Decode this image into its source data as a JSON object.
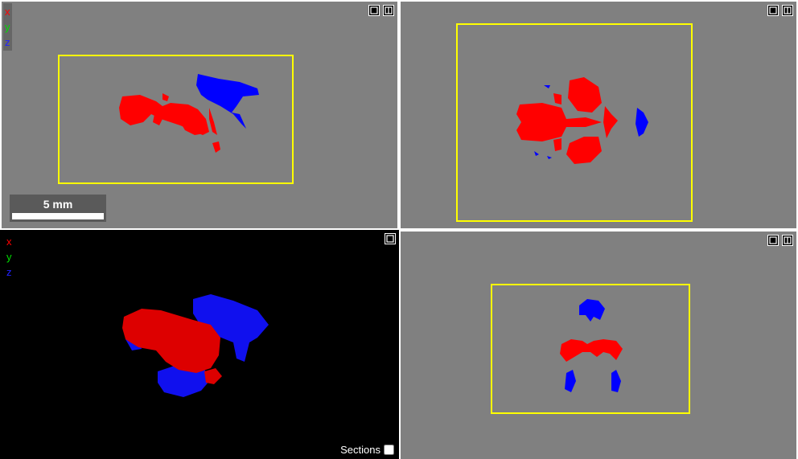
{
  "axes": {
    "x": "x",
    "y": "y",
    "z": "z"
  },
  "scale_bar": {
    "label": "5 mm"
  },
  "sections": {
    "label": "Sections",
    "checked": false
  },
  "colors": {
    "segment_a": "#ff0000",
    "segment_b": "#0000ff",
    "bounding_box": "#ffff00",
    "panel_bg": "#808080",
    "view3d_bg": "#000000"
  },
  "icons": {
    "maximize": "square-icon",
    "split": "split-view-icon"
  }
}
